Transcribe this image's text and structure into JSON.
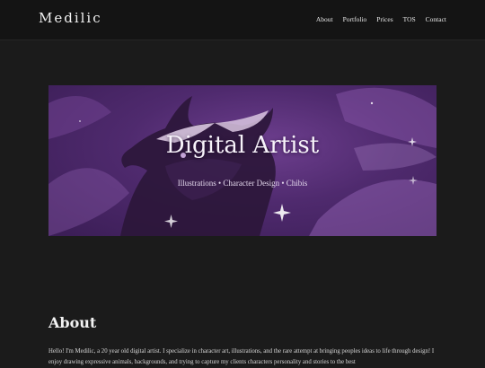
{
  "header": {
    "brand": "Medilic",
    "nav": [
      "About",
      "Portfolio",
      "Prices",
      "TOS",
      "Contact"
    ]
  },
  "hero": {
    "title": "Digital Artist",
    "subtitle": "Illustrations • Character Design • Chibis"
  },
  "about": {
    "heading": "About",
    "text": "Hello! I'm Medilic, a 20 year old digital artist. I specialize in character art, illustrations, and the rare attempt at bringing peoples ideas to life through design! I enjoy drawing expressive animals, backgrounds, and trying to capture my clients characters personality and stories to the best"
  },
  "colors": {
    "background": "#1b1b1b",
    "header": "#141414",
    "hero_purple": "#5a2f7a"
  }
}
